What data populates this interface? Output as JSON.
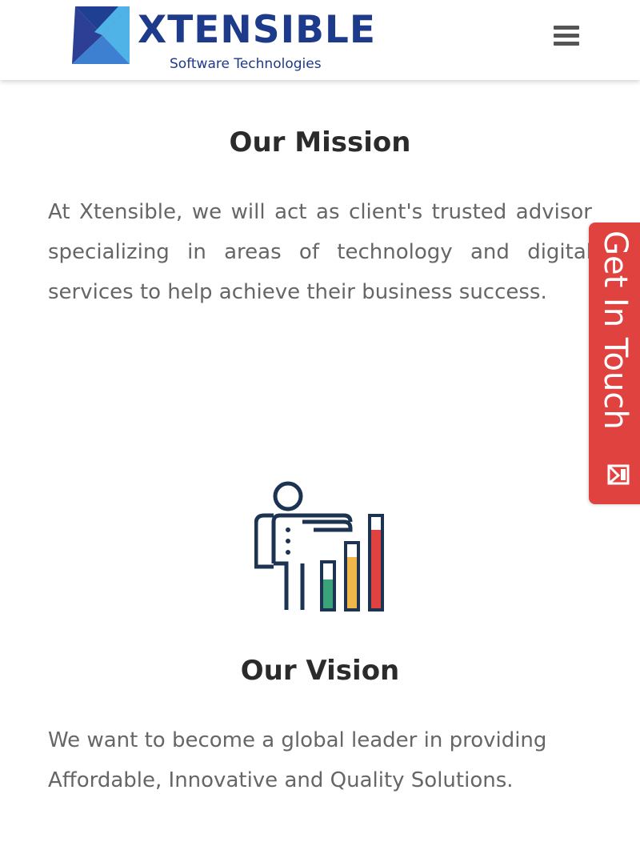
{
  "brand": {
    "name": "XTENSIBLE",
    "tagline": "Software Technologies",
    "colors": {
      "primary": "#1e3a8a",
      "accent_light": "#4fb3e8",
      "accent_dark": "#1f3f93"
    }
  },
  "header": {
    "menu_icon": "hamburger-menu-icon"
  },
  "mission": {
    "title": "Our Mission",
    "text": "At Xtensible, we will act as client's trusted advisor specializing in areas of technology and digital services to help achieve their business success."
  },
  "vision": {
    "icon": "presenter-bar-chart-icon",
    "title": "Our Vision",
    "text": "We want to become a global leader in providing Affordable, Innovative and Quality Solutions."
  },
  "contact_tab": {
    "label": "Get In Touch",
    "icon": "envelope-icon",
    "color": "#e0423f"
  }
}
